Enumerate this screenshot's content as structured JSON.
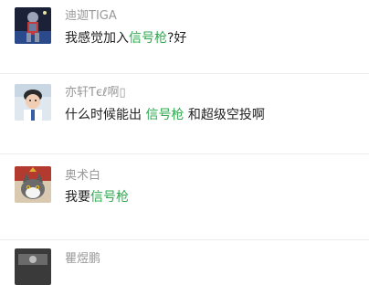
{
  "comments": [
    {
      "name": "迪迦TIGA",
      "avatar": "tiga-hero-avatar",
      "text_before": "我感觉加入",
      "highlight": "信号枪",
      "text_after": "?好"
    },
    {
      "name": "亦轩Ƭєℓ啊▯",
      "avatar": "boy-avatar",
      "text_before": "什么时候能出 ",
      "highlight": "信号枪",
      "text_after": " 和超级空投啊"
    },
    {
      "name": "奥术白",
      "avatar": "cat-avatar",
      "text_before": "我要",
      "highlight": "信号枪",
      "text_after": ""
    },
    {
      "name": "瞿煜鹏",
      "avatar": "dark-avatar",
      "text_before": "",
      "highlight": "",
      "text_after": ""
    }
  ],
  "colors": {
    "highlight": "#2fa84f",
    "name": "#999999",
    "text": "#222222",
    "divider": "#ececec"
  }
}
